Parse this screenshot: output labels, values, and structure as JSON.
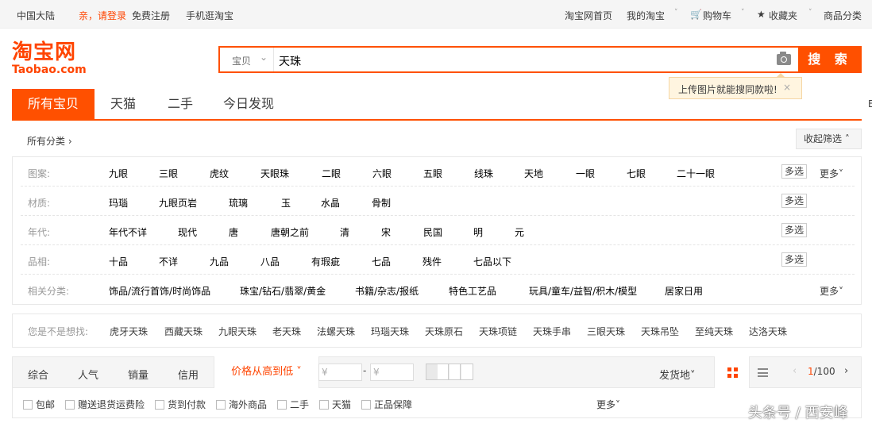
{
  "topbar": {
    "region": "中国大陆",
    "login": "亲，请登录",
    "register": "免费注册",
    "mobile": "手机逛淘宝",
    "home": "淘宝网首页",
    "my": "我的淘宝",
    "cart": "购物车",
    "fav": "收藏夹",
    "categories": "商品分类",
    "caret": "˅",
    "cart_icon": "🛒",
    "star_icon": "★"
  },
  "logo": {
    "cn": "淘宝网",
    "en": "Taobao.com"
  },
  "search": {
    "type": "宝贝",
    "type_caret": "⌄",
    "query": "天珠",
    "button": "搜 索",
    "tip": "上传图片就能搜同款啦!",
    "tip_close": "×",
    "camera_icon": "camera-icon"
  },
  "tabs": [
    "所有宝贝",
    "天猫",
    "二手",
    "今日发现"
  ],
  "crumb": "所有分类 ›",
  "collapse": "收起筛选 ˄",
  "filters": [
    {
      "label": "图案:",
      "items": [
        "九眼",
        "三眼",
        "虎纹",
        "天眼珠",
        "二眼",
        "六眼",
        "五眼",
        "线珠",
        "天地",
        "一眼",
        "七眼",
        "二十一眼"
      ],
      "multi": "多选",
      "more": "更多˅"
    },
    {
      "label": "材质:",
      "items": [
        "玛瑙",
        "九眼页岩",
        "琉璃",
        "玉",
        "水晶",
        "骨制"
      ],
      "multi": "多选",
      "more": ""
    },
    {
      "label": "年代:",
      "items": [
        "年代不详",
        "现代",
        "唐",
        "唐朝之前",
        "清",
        "宋",
        "民国",
        "明",
        "元"
      ],
      "multi": "多选",
      "more": ""
    },
    {
      "label": "品相:",
      "items": [
        "十品",
        "不详",
        "九品",
        "八品",
        "有瑕疵",
        "七品",
        "残件",
        "七品以下"
      ],
      "multi": "多选",
      "more": ""
    },
    {
      "label": "相关分类:",
      "items": [
        "饰品/流行首饰/时尚饰品",
        "珠宝/钻石/翡翠/黄金",
        "书籍/杂志/报纸",
        "特色工艺品",
        "玩具/童车/益智/积木/模型",
        "居家日用"
      ],
      "multi": "",
      "more": "更多˅"
    }
  ],
  "related": {
    "label": "您是不是想找:",
    "items": [
      "虎牙天珠",
      "西藏天珠",
      "九眼天珠",
      "老天珠",
      "法螺天珠",
      "玛瑙天珠",
      "天珠原石",
      "天珠项链",
      "天珠手串",
      "三眼天珠",
      "天珠吊坠",
      "至纯天珠",
      "达洛天珠"
    ]
  },
  "sort": {
    "items": [
      "综合",
      "人气",
      "销量",
      "信用"
    ],
    "price": "价格从高到低 ˅",
    "currency": "¥",
    "dash": "-",
    "location": "发货地˅",
    "page_current": "1",
    "page_total": "/100",
    "prev": "‹",
    "next": "›"
  },
  "checks": [
    "包邮",
    "赠送退货运费险",
    "货到付款",
    "海外商品",
    "二手",
    "天猫",
    "正品保障"
  ],
  "checks_more": "更多˅",
  "watermark": "头条号 / 西安峰",
  "right_edge": "E",
  "colors": {
    "accent": "#ff5000",
    "active_text": "#f40"
  }
}
